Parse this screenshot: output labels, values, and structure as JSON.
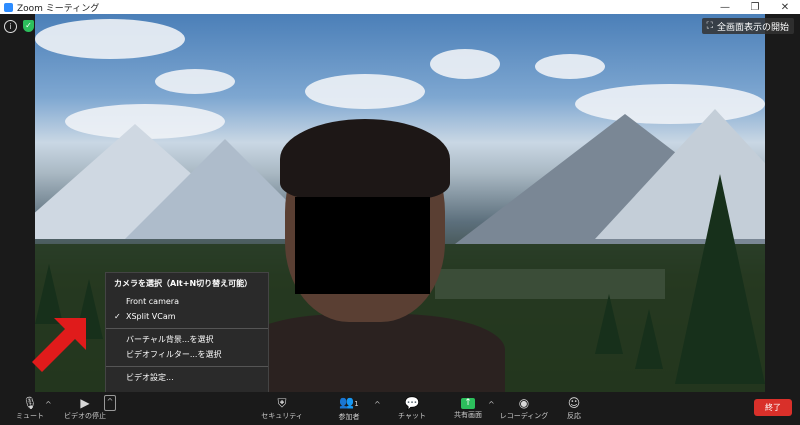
{
  "window": {
    "title": "Zoom ミーティング",
    "controls": [
      "—",
      "❐",
      "✕"
    ]
  },
  "overlay": {
    "info_glyph": "i",
    "shield_glyph": "✓",
    "fullscreen_label": "全画面表示の開始",
    "fullscreen_glyph": "⛶"
  },
  "camera_menu": {
    "header": "カメラを選択（Alt+N切り替え可能）",
    "items": [
      {
        "label": "Front camera",
        "checked": false
      },
      {
        "label": "XSplit VCam",
        "checked": true
      }
    ],
    "check_glyph": "✓",
    "actions": [
      "バーチャル背景...を選択",
      "ビデオフィルター...を選択"
    ],
    "settings": "ビデオ設定..."
  },
  "toolbar": {
    "mute": {
      "label": "ミュート",
      "glyph": "🎙"
    },
    "video": {
      "label": "ビデオの停止",
      "glyph": "▶"
    },
    "security": {
      "label": "セキュリティ",
      "glyph": "⛨"
    },
    "participants": {
      "label": "参加者",
      "glyph": "👥",
      "count": "1"
    },
    "chat": {
      "label": "チャット",
      "glyph": "💬"
    },
    "share": {
      "label": "共有画面",
      "glyph": "↑"
    },
    "record": {
      "label": "レコーディング",
      "glyph": "◉"
    },
    "reactions": {
      "label": "反応",
      "glyph": "☺"
    },
    "caret_glyph": "^",
    "end": {
      "label": "終了"
    }
  },
  "colors": {
    "share_green": "#2cbf5c",
    "end_red": "#d9302a",
    "arrow_red": "#e01b1b",
    "zoom_blue": "#2d8cff"
  }
}
